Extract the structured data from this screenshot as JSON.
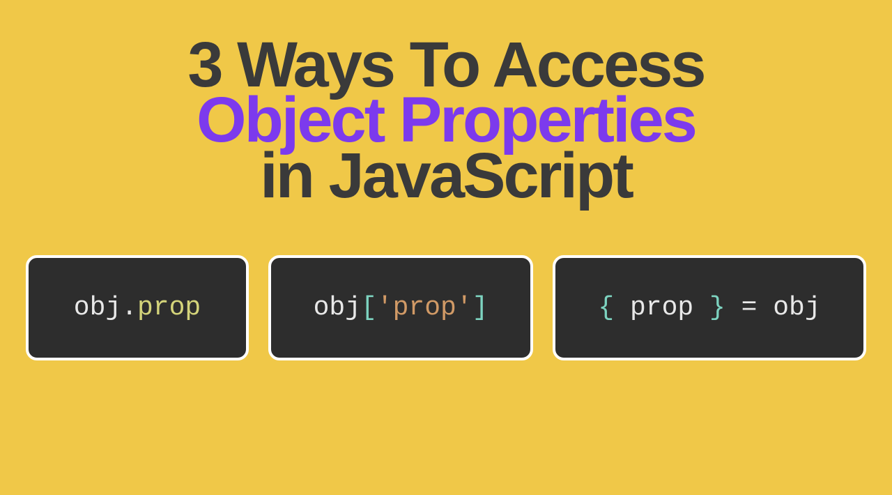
{
  "title": {
    "line1": "3 Ways To Access",
    "line2": "Object Properties",
    "line3": "in JavaScript"
  },
  "code_examples": [
    {
      "parts": [
        {
          "text": "obj",
          "style": "white"
        },
        {
          "text": ".",
          "style": "white"
        },
        {
          "text": "prop",
          "style": "yellow"
        }
      ]
    },
    {
      "parts": [
        {
          "text": "obj",
          "style": "white"
        },
        {
          "text": "[",
          "style": "cyan"
        },
        {
          "text": "'prop'",
          "style": "orange"
        },
        {
          "text": "]",
          "style": "cyan"
        }
      ]
    },
    {
      "parts": [
        {
          "text": "{ ",
          "style": "cyan"
        },
        {
          "text": "prop",
          "style": "white"
        },
        {
          "text": " }",
          "style": "cyan"
        },
        {
          "text": " = ",
          "style": "white"
        },
        {
          "text": "obj",
          "style": "white"
        }
      ]
    }
  ]
}
